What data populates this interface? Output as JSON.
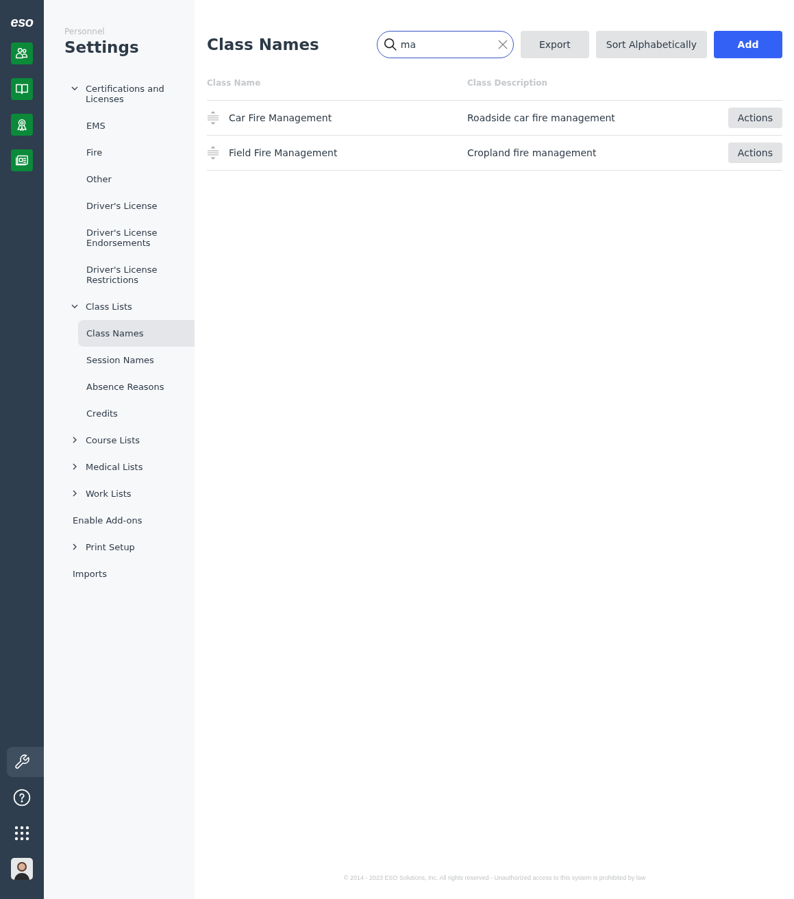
{
  "rail": {
    "logo": "eso",
    "apps": [
      {
        "kind": "people"
      },
      {
        "kind": "book"
      },
      {
        "kind": "award"
      },
      {
        "kind": "news"
      }
    ],
    "tools": [
      {
        "kind": "wrench",
        "selected": true
      },
      {
        "kind": "help",
        "selected": false
      },
      {
        "kind": "grid",
        "selected": false
      },
      {
        "kind": "avatar",
        "selected": false
      }
    ]
  },
  "sidebar": {
    "section": "Personnel",
    "title": "Settings",
    "items": [
      {
        "label": "Certifications and Licenses",
        "expanded": true,
        "children": [
          {
            "label": "EMS",
            "selected": false
          },
          {
            "label": "Fire",
            "selected": false
          },
          {
            "label": "Other",
            "selected": false
          },
          {
            "label": "Driver's License",
            "selected": false
          },
          {
            "label": "Driver's License Endorsements",
            "selected": false
          },
          {
            "label": "Driver's License Restrictions",
            "selected": false
          }
        ]
      },
      {
        "label": "Class Lists",
        "expanded": true,
        "children": [
          {
            "label": "Class Names",
            "selected": true
          },
          {
            "label": "Session Names",
            "selected": false
          },
          {
            "label": "Absence Reasons",
            "selected": false
          },
          {
            "label": "Credits",
            "selected": false
          }
        ]
      },
      {
        "label": "Course Lists",
        "expanded": false
      },
      {
        "label": "Medical Lists",
        "expanded": false
      },
      {
        "label": "Work Lists",
        "expanded": false
      },
      {
        "label": "Enable Add-ons"
      },
      {
        "label": "Print Setup",
        "expanded": false
      },
      {
        "label": "Imports"
      }
    ]
  },
  "page": {
    "title": "Class Names",
    "search": {
      "value": "ma"
    },
    "buttons": [
      {
        "label": "Export",
        "kind": "secondary"
      },
      {
        "label": "Sort Alphabetically",
        "kind": "secondary"
      },
      {
        "label": "Add",
        "kind": "primary"
      }
    ]
  },
  "table": {
    "columns": [
      "Class Name",
      "Class Description"
    ],
    "rows": [
      {
        "name": "Car Fire Management",
        "description": "Roadside car fire management",
        "action": "Actions"
      },
      {
        "name": "Field Fire Management",
        "description": "Cropland fire management",
        "action": "Actions"
      }
    ]
  },
  "footer": "© 2014 - 2023 ESO Solutions, Inc. All rights reserved - Unauthorized access to this system is prohibited by law"
}
